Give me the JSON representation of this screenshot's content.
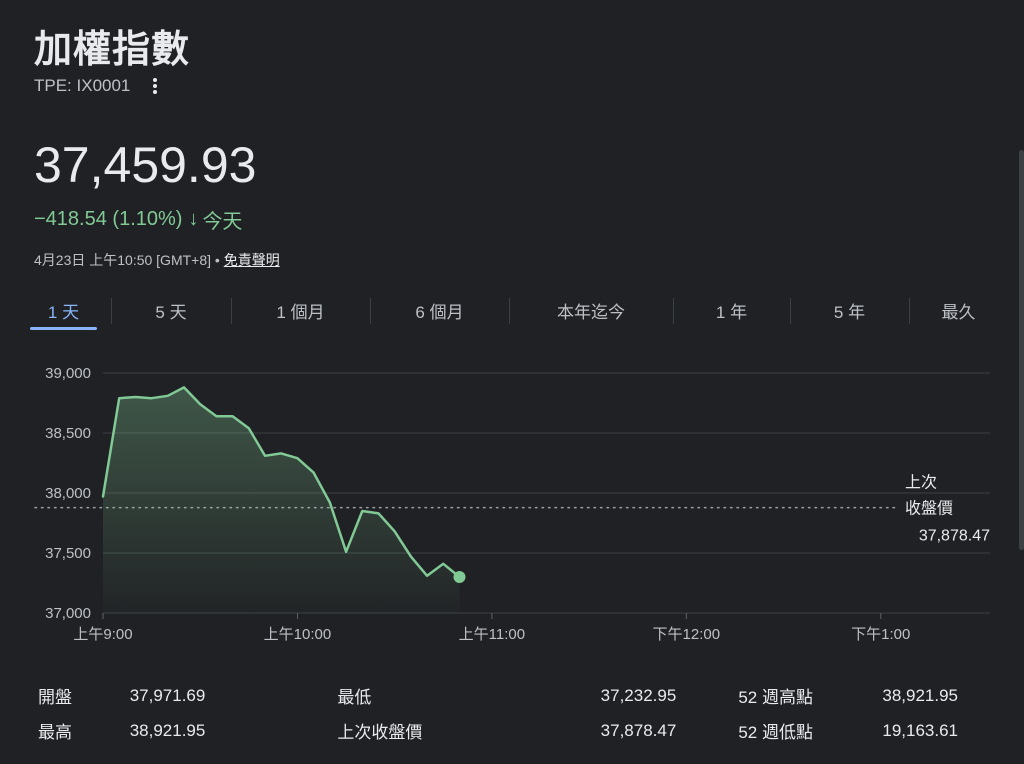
{
  "header": {
    "title": "加權指數",
    "ticker": "TPE: IX0001",
    "more_icon": "more-vert-icon"
  },
  "quote": {
    "price": "37,459.93",
    "change": "−418.54 (1.10%)",
    "arrow": "↓",
    "period": "今天",
    "timestamp": "4月23日 上午10:50 [GMT+8]",
    "separator": "•",
    "disclaimer": "免責聲明"
  },
  "tabs": [
    {
      "label": "1 天",
      "active": true
    },
    {
      "label": "5 天",
      "active": false
    },
    {
      "label": "1 個月",
      "active": false
    },
    {
      "label": "6 個月",
      "active": false
    },
    {
      "label": "本年迄今",
      "active": false
    },
    {
      "label": "1 年",
      "active": false
    },
    {
      "label": "5 年",
      "active": false
    },
    {
      "label": "最久",
      "active": false
    }
  ],
  "colors": {
    "background": "#202124",
    "line": "#81c995",
    "grid": "#3c4043",
    "text": "#e8eaed",
    "accent": "#8ab4f8"
  },
  "chart_data": {
    "type": "area",
    "ylim": [
      37000,
      39000
    ],
    "yticks": [
      37000,
      37500,
      38000,
      38500,
      39000
    ],
    "ytick_labels": [
      "37,000",
      "37,500",
      "38,000",
      "38,500",
      "39,000"
    ],
    "xlim": [
      "09:00",
      "13:30"
    ],
    "xticks": [
      "09:00",
      "10:00",
      "11:00",
      "12:00",
      "13:00"
    ],
    "xtick_labels": [
      "上午9:00",
      "上午10:00",
      "上午11:00",
      "下午12:00",
      "下午1:00"
    ],
    "previous_close": {
      "value": 37878.47,
      "label_line1": "上次",
      "label_line2": "收盤價",
      "value_label": "37,878.47"
    },
    "series": [
      {
        "x": [
          "09:00",
          "09:05",
          "09:10",
          "09:15",
          "09:20",
          "09:25",
          "09:30",
          "09:35",
          "09:40",
          "09:45",
          "09:50",
          "09:55",
          "10:00",
          "10:05",
          "10:10",
          "10:15",
          "10:20",
          "10:25",
          "10:30",
          "10:35",
          "10:40",
          "10:45",
          "10:50"
        ],
        "values": [
          37971,
          38790,
          38800,
          38790,
          38810,
          38880,
          38740,
          38640,
          38640,
          38540,
          38310,
          38330,
          38290,
          38170,
          37920,
          37510,
          37850,
          37830,
          37680,
          37470,
          37310,
          37410,
          37300
        ]
      }
    ]
  },
  "stats": [
    [
      {
        "label": "開盤",
        "value": "37,971.69"
      },
      {
        "label": "最低",
        "value": "37,232.95"
      },
      {
        "label": "52 週高點",
        "value": "38,921.95"
      }
    ],
    [
      {
        "label": "最高",
        "value": "38,921.95"
      },
      {
        "label": "上次收盤價",
        "value": "37,878.47"
      },
      {
        "label": "52 週低點",
        "value": "19,163.61"
      }
    ]
  ]
}
